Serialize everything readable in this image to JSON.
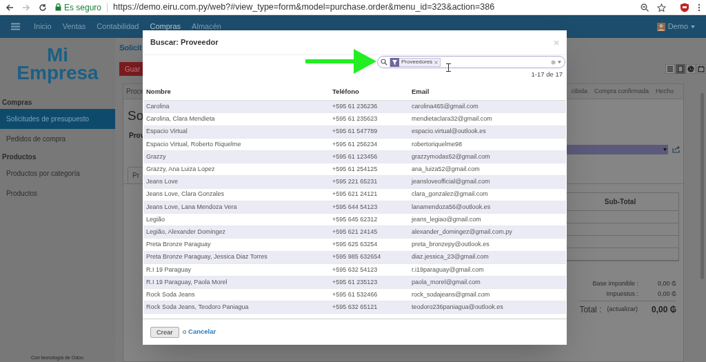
{
  "browser": {
    "security": "Es seguro",
    "url": "https://demo.eiru.com.py/web?#view_type=form&model=purchase.order&menu_id=323&action=386"
  },
  "navbar": {
    "items": [
      {
        "label": "Inicio",
        "selected": false
      },
      {
        "label": "Ventas",
        "selected": false
      },
      {
        "label": "Contabilidad",
        "selected": false
      },
      {
        "label": "Compras",
        "selected": true
      },
      {
        "label": "Almacén",
        "selected": false
      }
    ],
    "user": "Demo"
  },
  "sidebar": {
    "logo": [
      "Mi",
      "Empresa"
    ],
    "sections": [
      {
        "title": "Compras",
        "items": [
          {
            "label": "Solicitudes de presupuesto",
            "selected": true
          },
          {
            "label": "Pedidos de compra",
            "selected": false
          }
        ]
      },
      {
        "title": "Productos",
        "items": [
          {
            "label": "Productos por categoría",
            "selected": false
          },
          {
            "label": "Productos",
            "selected": false
          }
        ]
      }
    ],
    "footer": "Con tecnología de Odoo"
  },
  "form": {
    "breadcrumb": "Solicit",
    "save_button": "Guar",
    "status_left": "Proce",
    "status_steps": [
      "cibida",
      "Compra confirmada",
      "Hecho"
    ],
    "title": "So",
    "field_label": "Prov",
    "tab": "Pr",
    "lines_header": "Sub-Total",
    "totals": [
      {
        "label": "Base imponible :",
        "value": "0,00 ₲"
      },
      {
        "label": "Impuestos :",
        "value": "0,00 ₲"
      }
    ],
    "total_label": "Total :",
    "update_link": "(actualizar)",
    "total_value": "0,00 ₲"
  },
  "dialog": {
    "title": "Buscar: Proveedor",
    "facet": "Proveedores",
    "pager": "1-17 de 17",
    "columns": [
      "Nombre",
      "Teléfono",
      "Email"
    ],
    "rows": [
      [
        "Carolina",
        "+595 61 236236",
        "carolina465@gmail.com"
      ],
      [
        "Carolina, Clara Mendieta",
        "+595 61 235623",
        "mendietaclara32@gmail.com"
      ],
      [
        "Espacio Virtual",
        "+595 61 547789",
        "espacio.virtual@outlook.es"
      ],
      [
        "Espacio Virtual, Roberto Riquelme",
        "+595 61 256234",
        "robertoriquelme98"
      ],
      [
        "Grazzy",
        "+595 61 123456",
        "grazzymodas52@gmail.com"
      ],
      [
        "Grazzy, Ana Luiza Lopez",
        "+595 61 254125",
        "ana_luiza52@gmail.com"
      ],
      [
        "Jeans Love",
        "+595 221 65231",
        "jeansloveofficial@gmail.com"
      ],
      [
        "Jeans Love, Clara Gonzales",
        "+595 621 24121",
        "clara_gonzalez@gmail.com"
      ],
      [
        "Jeans Love, Lana Mendoza Vera",
        "+595 644 54123",
        "lanamendoza56@outlook.es"
      ],
      [
        "Legião",
        "+595 645 62312",
        "jeans_legiao@gmail.com"
      ],
      [
        "Legião, Alexander Domingez",
        "+595 621 24145",
        "alexander_domingez@gmail.com.py"
      ],
      [
        "Preta Bronze Paraguay",
        "+595 625 63254",
        "preta_bronzepy@outlook.es"
      ],
      [
        "Preta Bronze Paraguay, Jessica Diaz Torres",
        "+595 985 632654",
        "diaz.jessica_23@gmail.com"
      ],
      [
        "R.I 19 Paraguay",
        "+595 632 54123",
        "r.i19paraguay@gmail.com"
      ],
      [
        "R.I 19 Paraguay, Paola Morel",
        "+595 61 235123",
        "paola_morel@gmail.com"
      ],
      [
        "Rock Soda Jeans",
        "+595 61 532466",
        "rock_sodajeans@gmail.com"
      ],
      [
        "Rock Soda Jeans, Teodoro Paniagua",
        "+595 632 65121",
        "teodoro236paniagua@outlook.es"
      ]
    ],
    "create_button": "Crear",
    "or": "o",
    "cancel_link": "Cancelar"
  }
}
